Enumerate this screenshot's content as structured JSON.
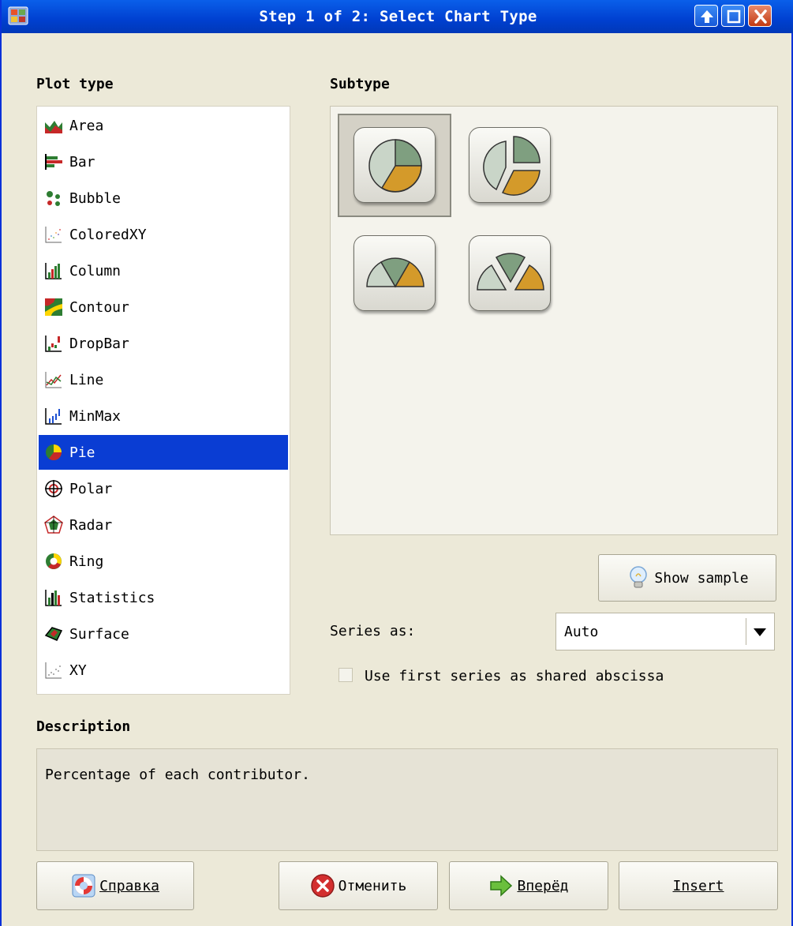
{
  "window": {
    "title": "Step 1 of 2: Select Chart Type"
  },
  "plot_type": {
    "label": "Plot type",
    "items": [
      {
        "label": "Area",
        "icon": "area-chart-icon"
      },
      {
        "label": "Bar",
        "icon": "bar-chart-icon"
      },
      {
        "label": "Bubble",
        "icon": "bubble-chart-icon"
      },
      {
        "label": "ColoredXY",
        "icon": "colored-xy-icon"
      },
      {
        "label": "Column",
        "icon": "column-chart-icon"
      },
      {
        "label": "Contour",
        "icon": "contour-chart-icon"
      },
      {
        "label": "DropBar",
        "icon": "dropbar-chart-icon"
      },
      {
        "label": "Line",
        "icon": "line-chart-icon"
      },
      {
        "label": "MinMax",
        "icon": "minmax-chart-icon"
      },
      {
        "label": "Pie",
        "icon": "pie-chart-icon"
      },
      {
        "label": "Polar",
        "icon": "polar-chart-icon"
      },
      {
        "label": "Radar",
        "icon": "radar-chart-icon"
      },
      {
        "label": "Ring",
        "icon": "ring-chart-icon"
      },
      {
        "label": "Statistics",
        "icon": "statistics-chart-icon"
      },
      {
        "label": "Surface",
        "icon": "surface-chart-icon"
      },
      {
        "label": "XY",
        "icon": "xy-chart-icon"
      }
    ],
    "selected": "Pie"
  },
  "subtype": {
    "label": "Subtype",
    "items": [
      "pie",
      "exploded-pie",
      "half-pie",
      "exploded-half-pie"
    ],
    "selected": "pie"
  },
  "show_sample": {
    "label": "Show sample",
    "icon": "lightbulb-icon"
  },
  "series_as": {
    "label": "Series as:",
    "value": "Auto"
  },
  "shared_abscissa": {
    "label": "Use first series as shared abscissa",
    "checked": false
  },
  "description": {
    "label": "Description",
    "text": "Percentage of each contributor."
  },
  "buttons": {
    "help": {
      "label": "Справка",
      "icon": "lifebuoy-icon"
    },
    "cancel": {
      "label": "Отменить",
      "icon": "cancel-icon"
    },
    "next": {
      "label": "Вперёд",
      "icon": "arrow-right-icon"
    },
    "insert": {
      "label": "Insert"
    }
  }
}
